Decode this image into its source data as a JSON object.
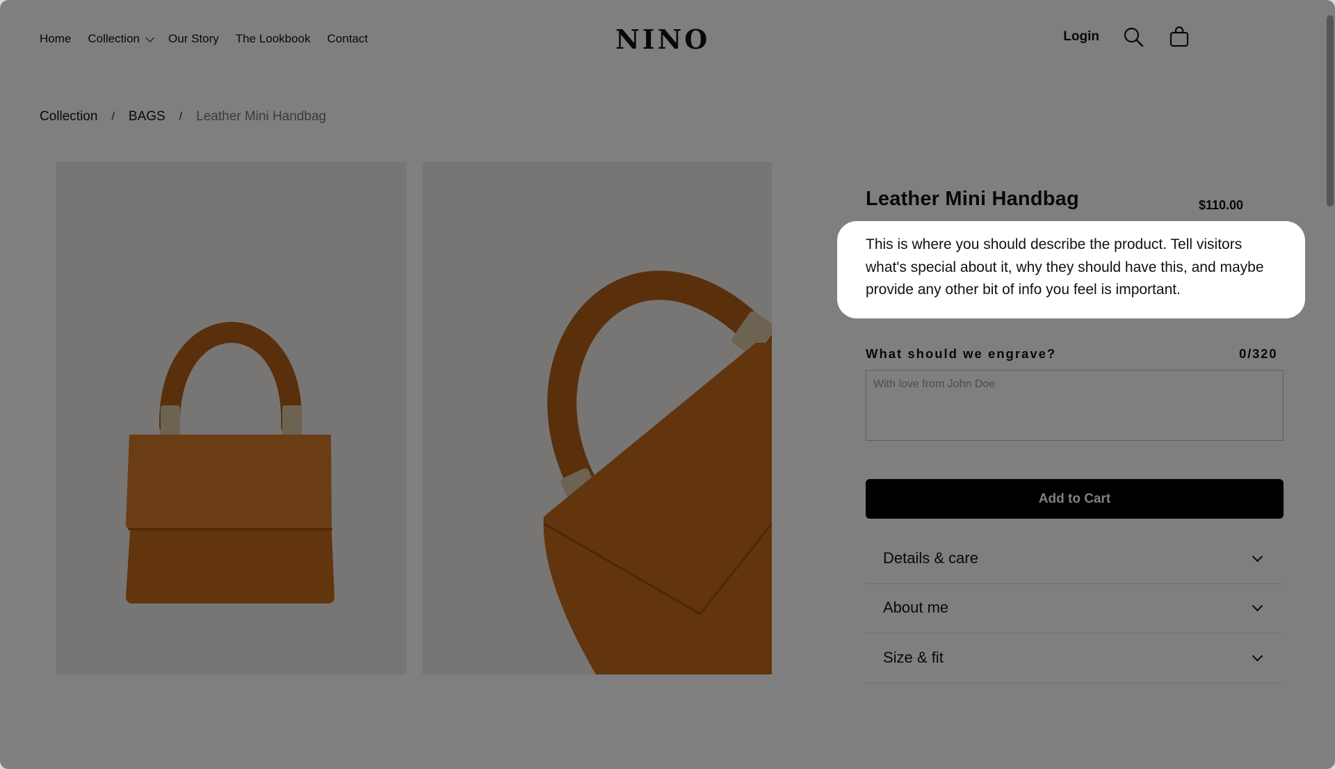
{
  "header": {
    "nav": [
      {
        "label": "Home"
      },
      {
        "label": "Collection"
      },
      {
        "label": "Our Story"
      },
      {
        "label": "The Lookbook"
      },
      {
        "label": "Contact"
      }
    ],
    "logo": "NINO",
    "login": "Login",
    "icons": [
      "search-icon",
      "shopping-bag-icon"
    ]
  },
  "breadcrumb": {
    "items": [
      "Collection",
      "BAGS",
      "Leather Mini Handbag"
    ],
    "separator": "/"
  },
  "product": {
    "title": "Leather Mini Handbag",
    "price": "$110.00",
    "description": "This is where you should describe the product. Tell visitors what's special about it, why they should have this, and maybe provide any other bit of info you feel is important.",
    "engrave_label": "What should we engrave?",
    "engrave_count": "0/320",
    "engrave_placeholder": "With love from John Doe",
    "add_to_cart": "Add to Cart",
    "accordions": [
      "Details & care",
      "About me",
      "Size & fit"
    ]
  },
  "colors": {
    "overlay": "rgba(0,0,0,0.5)",
    "button": "#000000",
    "bag": "#c56a1c",
    "image_bg": "#efedea"
  }
}
